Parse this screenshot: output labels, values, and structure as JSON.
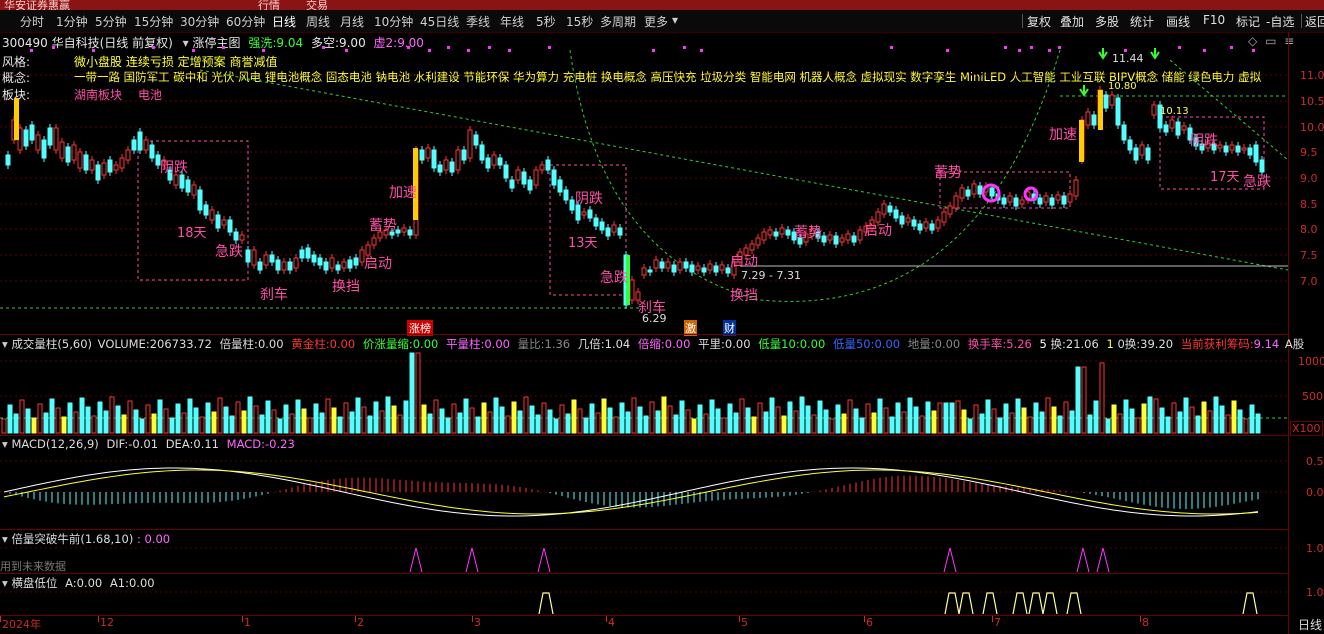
{
  "topbar": {
    "left": "华安证券惠赢",
    "tab1": "行情",
    "tab2": "交易"
  },
  "periods": [
    "分时",
    "1分钟",
    "5分钟",
    "15分钟",
    "30分钟",
    "60分钟",
    "日线",
    "周线",
    "月线",
    "10分钟",
    "45日线",
    "季线",
    "年线",
    "5秒",
    "15秒",
    "多周期",
    "更多"
  ],
  "active_period": "日线",
  "toolbar": {
    "fuquan": "复权",
    "diejia": "叠加",
    "duogu": "多股",
    "tongji": "统计",
    "huaxian": "画线",
    "f10": "F10",
    "biaoji": "标记",
    "zixuan": "-自选",
    "fanhui": "返回"
  },
  "main_header": {
    "stock": "300490 华自科技(日线 前复权)",
    "indicator": "涨停主图",
    "qiangxi_label": "强洗:",
    "qiangxi": "9.04",
    "duokong_label": "多空:",
    "duokong": "9.00",
    "xu_label": "虚2:",
    "xu": "9.00"
  },
  "info": {
    "fengge_label": "风格:",
    "fengge": "微小盘股 连续亏损 定增预案 商誉减值",
    "gainian_label": "概念:",
    "gainian": "一带一路 国防军工 碳中和 光伏 风电 锂电池概念 固态电池 钠电池 水利建设 节能环保 华为算力 充电桩 换电概念 高压快充 垃圾分类 智能电网 机器人概念 虚拟现实 数字孪生 MiniLED 人工智能 工业互联 BIPV概念 储能 绿色电力 虚拟",
    "bankuai_label": "板块:",
    "bankuai1": "湖南板块",
    "bankuai2": "电池"
  },
  "price_axis": [
    "11.0",
    "10.5",
    "10.0",
    "9.5",
    "9.0",
    "8.5",
    "8.0",
    "7.5",
    "7.0"
  ],
  "annotations": {
    "yindie1": "阴跌",
    "days18": "18天",
    "jidie1": "急跌",
    "shache1": "刹车",
    "huandang1": "换挡",
    "xuneng1": "蓄势",
    "qidong1": "启动",
    "jiasu1": "加速",
    "yindie2": "阴跌",
    "days13": "13天",
    "jidie2": "急跌",
    "shache2": "刹车",
    "qidong2": "启动",
    "huandang2": "换挡",
    "xuneng2": "蓄势",
    "qidong3": "启动",
    "xuneng3": "蓄势",
    "jiasu2": "加速",
    "yindie3": "阴跌",
    "days17": "17天",
    "jidie3": "急跌",
    "low_price": "6.29",
    "range_text": "7.29 - 7.31",
    "high_price": "11.44",
    "p1080": "10.80",
    "p1013": "10.13"
  },
  "markers": {
    "zhangbang": "涨榜",
    "ji": "激",
    "cai": "财"
  },
  "vol_header": {
    "name": "成交量柱(5,60)",
    "volume_label": "VOLUME:",
    "volume": "206733.72",
    "beiliang_label": "倍量柱:",
    "beiliang": "0.00",
    "huangjin_label": "黄金柱:",
    "huangjin": "0.00",
    "jiazhang_label": "价涨量缩:",
    "jiazhang": "0.00",
    "pingliang_label": "平量柱:",
    "pingliang": "0.00",
    "liangbi_label": "量比:",
    "liangbi": "1.36",
    "jibei_label": "几倍:",
    "jibei": "1.04",
    "beisuo_label": "倍缩:",
    "beisuo": "0.00",
    "pingli_label": "平里:",
    "pingli": "0.00",
    "diliang10_label": "低量10:",
    "diliang10": "0.00",
    "diliang50_label": "低量50:",
    "diliang50": "0.00",
    "diliang_label": "地量:",
    "diliang": "0.00",
    "huanshou_label": "换手率:",
    "huanshou": "5.26",
    "five_label": "5",
    "huan_label": "换:",
    "huan": "21.06",
    "one_label": "1",
    "zero_label": "0换:",
    "zerohuan": "39.20",
    "dangqian_label": "当前获利筹码:",
    "dangqian": "9.14",
    "ashare": "A股"
  },
  "vol_axis": [
    "1000",
    "500",
    "X100"
  ],
  "macd_header": {
    "name": "MACD(12,26,9)",
    "dif_label": "DIF:",
    "dif": "-0.01",
    "dea_label": "DEA:",
    "dea": "0.11",
    "macd_label": "MACD:",
    "macd": "-0.23"
  },
  "macd_axis": [
    "0.5",
    "0.0"
  ],
  "bl_header": {
    "name": "倍量突破牛前(1.68,10)",
    "value": ": 0.00",
    "note": "用到未来数据"
  },
  "bl_axis": [
    "1.0"
  ],
  "hp_header": {
    "name": "横盘低位",
    "a_label": "A:",
    "a": "0.00",
    "a1_label": "A1:",
    "a1": "0.00"
  },
  "hp_axis": [
    "1.0"
  ],
  "time_axis": [
    "2024年",
    "12",
    "1",
    "2",
    "3",
    "4",
    "5",
    "6",
    "7",
    "8"
  ],
  "bottom_right": "日线",
  "colors": {
    "up": "#ff3333",
    "down": "#54ffff",
    "pink": "#ff4da6",
    "yellow": "#ffff33",
    "green": "#33cc33",
    "border": "#6b0000"
  }
}
